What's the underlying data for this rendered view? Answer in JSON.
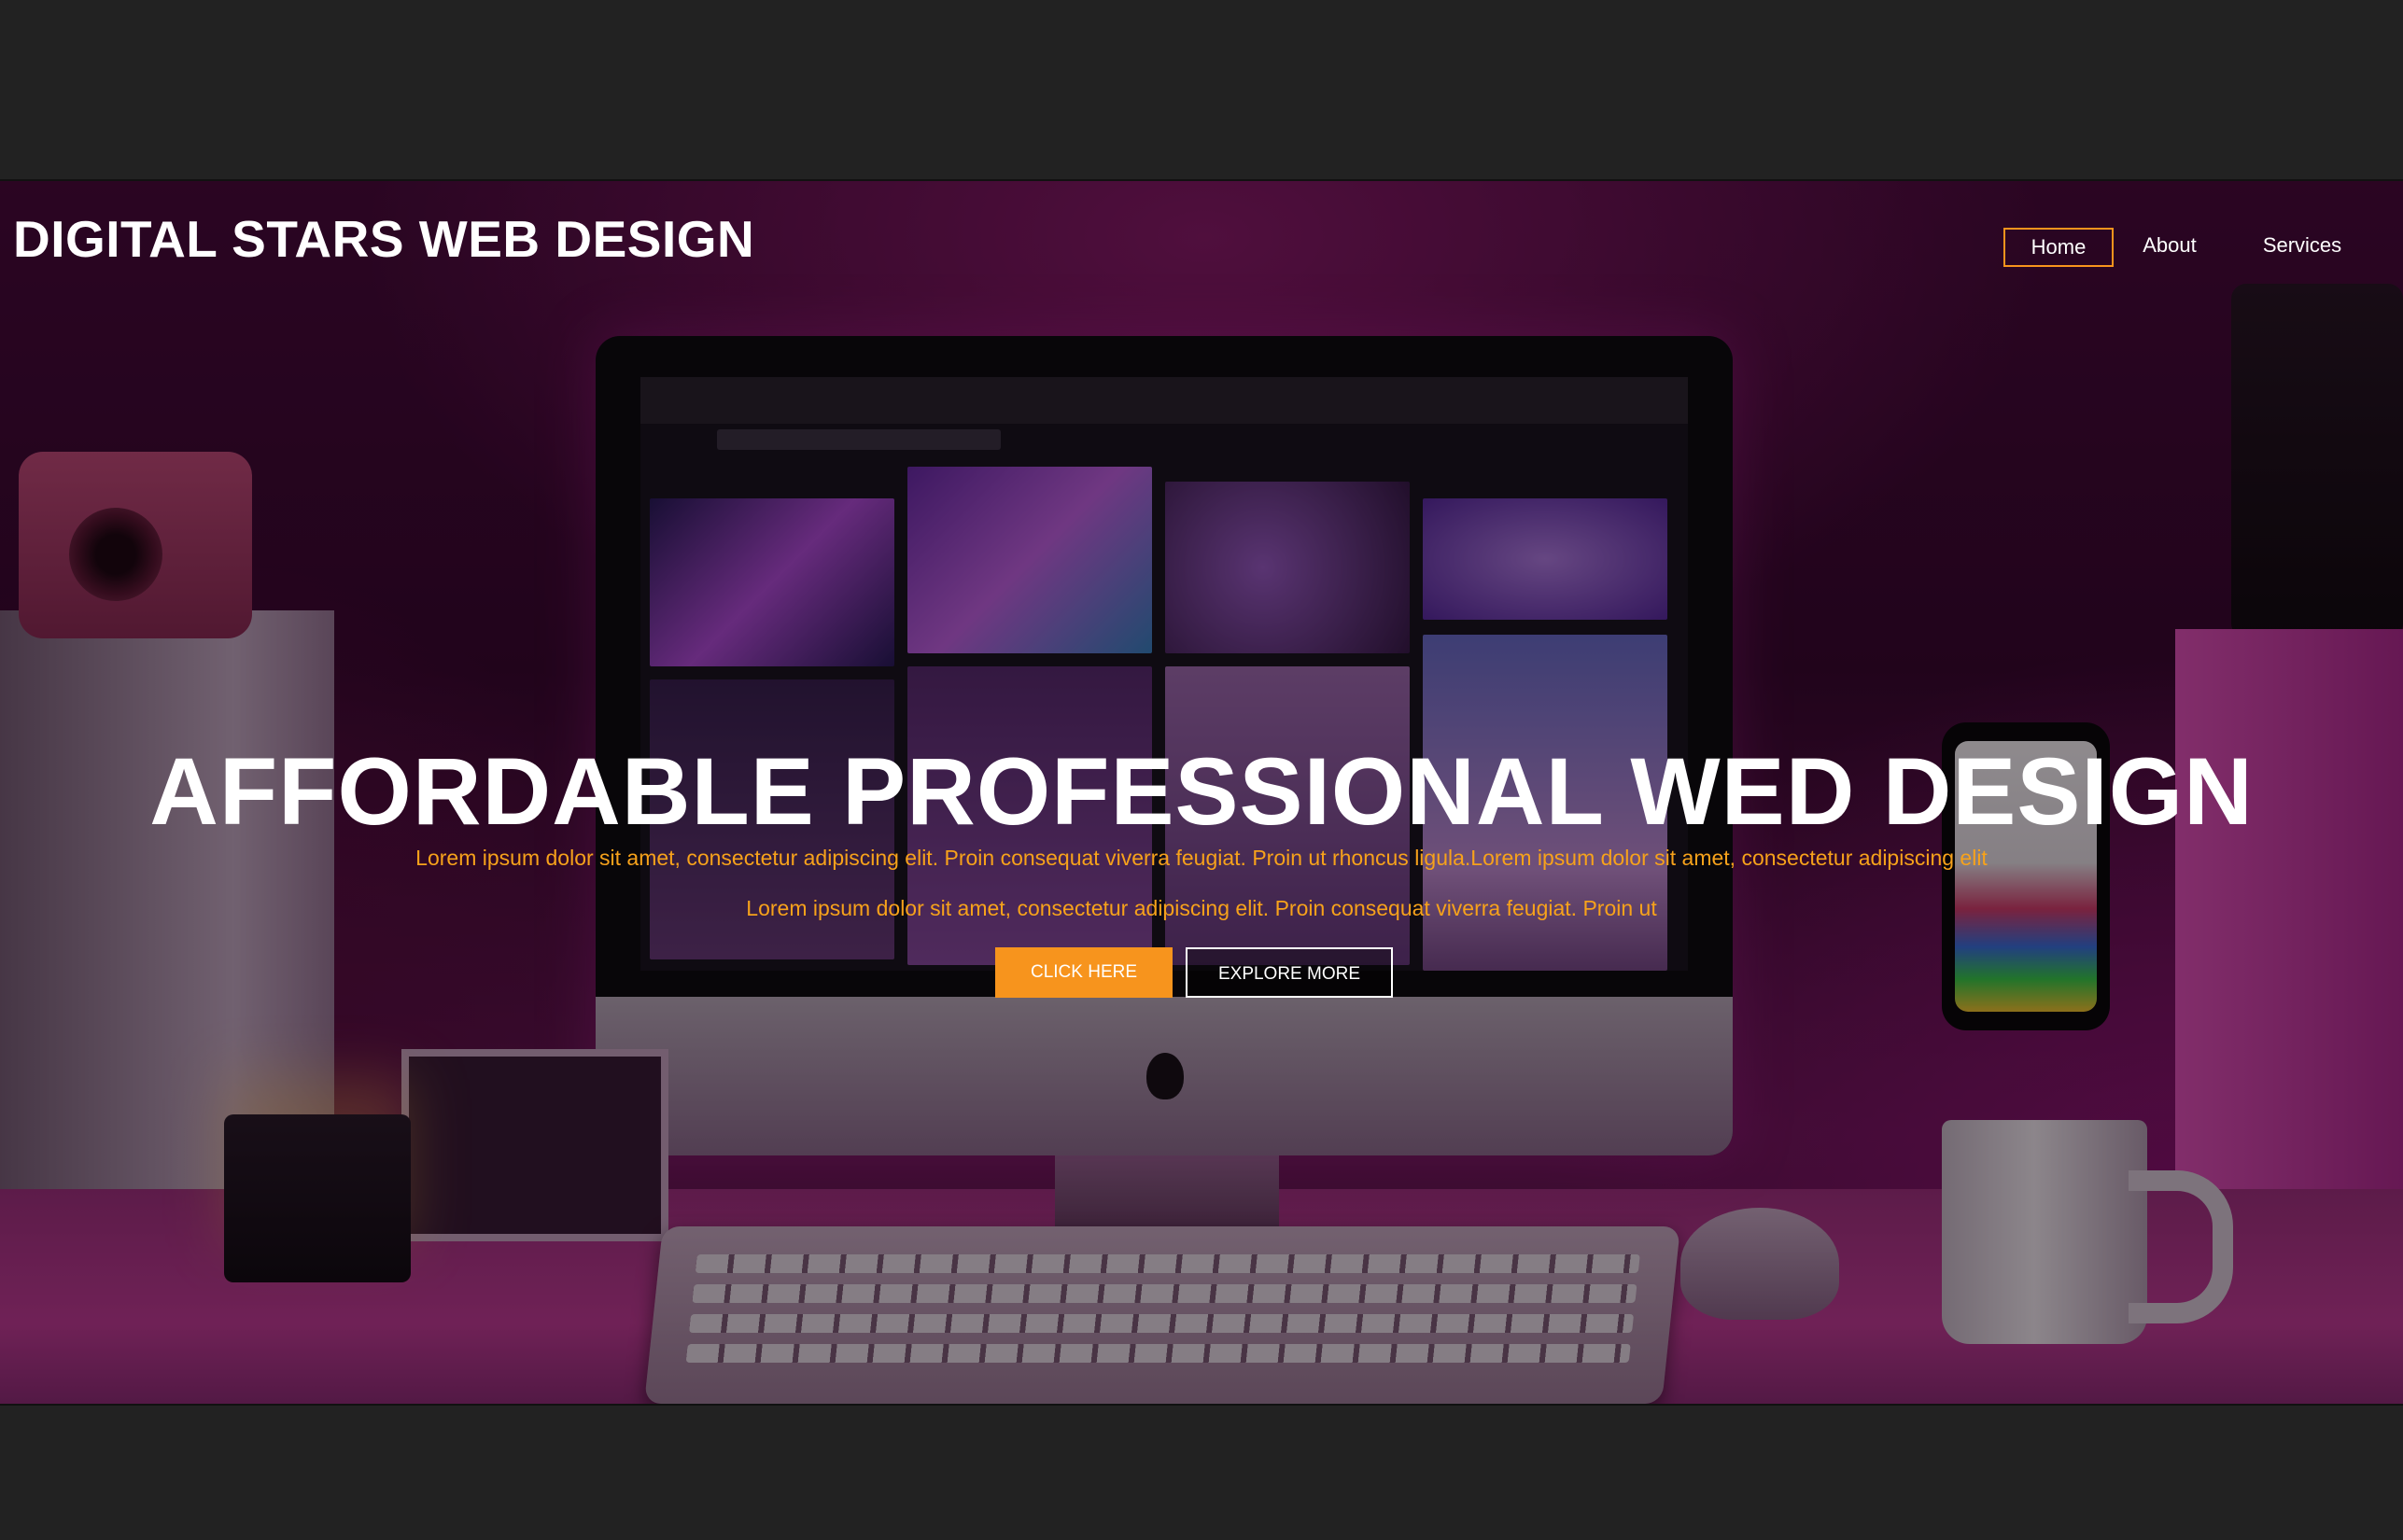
{
  "header": {
    "brand": "DIGITAL STARS WEB DESIGN",
    "nav": [
      {
        "label": "Home",
        "active": true
      },
      {
        "label": "About",
        "active": false
      },
      {
        "label": "Services",
        "active": false
      }
    ]
  },
  "hero": {
    "headline": "AFFORDABLE PROFESSIONAL WED DESIGN",
    "subtext_line1": "Lorem ipsum dolor sit amet, consectetur adipiscing elit. Proin consequat viverra feugiat. Proin ut rhoncus ligula.Lorem ipsum dolor sit amet, consectetur adipiscing elit",
    "subtext_line2": "Lorem ipsum dolor sit amet, consectetur adipiscing elit. Proin consequat viverra feugiat. Proin ut",
    "primary_button": "CLICK HERE",
    "secondary_button": "EXPLORE MORE"
  },
  "colors": {
    "accent": "#f7941d",
    "subtext": "#f7a21b",
    "background": "#222222",
    "text": "#ffffff"
  }
}
